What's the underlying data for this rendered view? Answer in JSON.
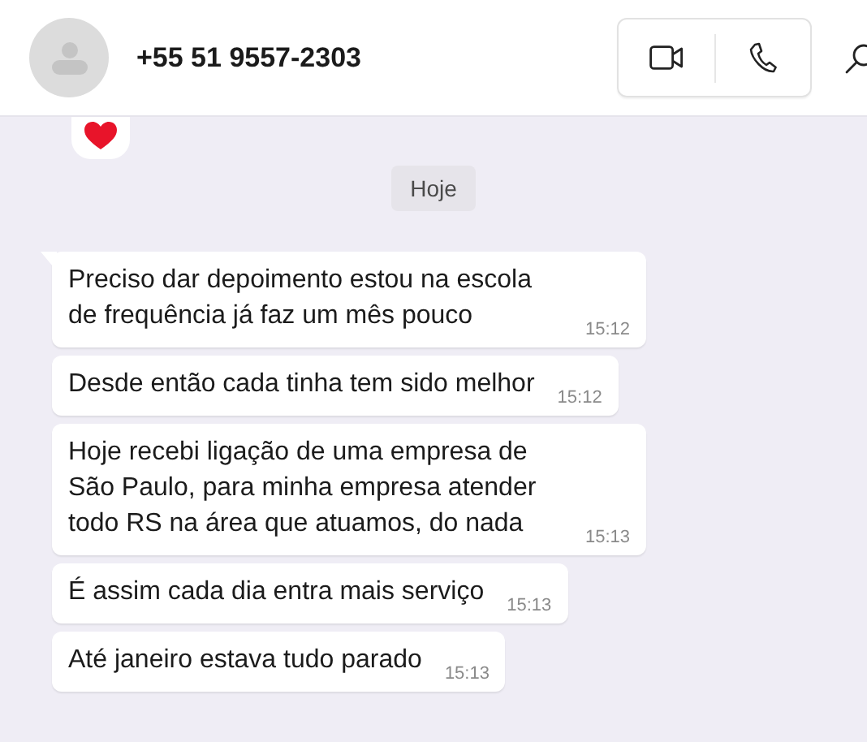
{
  "header": {
    "contact_name": "+55 51 9557-2303"
  },
  "date_chip": "Hoje",
  "messages": [
    {
      "text": "Preciso dar depoimento estou na escola de frequência já faz um mês pouco",
      "time": "15:12",
      "tail": true
    },
    {
      "text": "Desde então cada tinha tem sido melhor",
      "time": "15:12",
      "tail": false
    },
    {
      "text": "Hoje recebi ligação de uma empresa de São Paulo, para minha empresa atender todo RS na área que atuamos, do nada",
      "time": "15:13",
      "tail": false
    },
    {
      "text": "É assim cada dia entra mais serviço",
      "time": "15:13",
      "tail": false
    },
    {
      "text": "Até janeiro estava tudo parado",
      "time": "15:13",
      "tail": false
    }
  ]
}
